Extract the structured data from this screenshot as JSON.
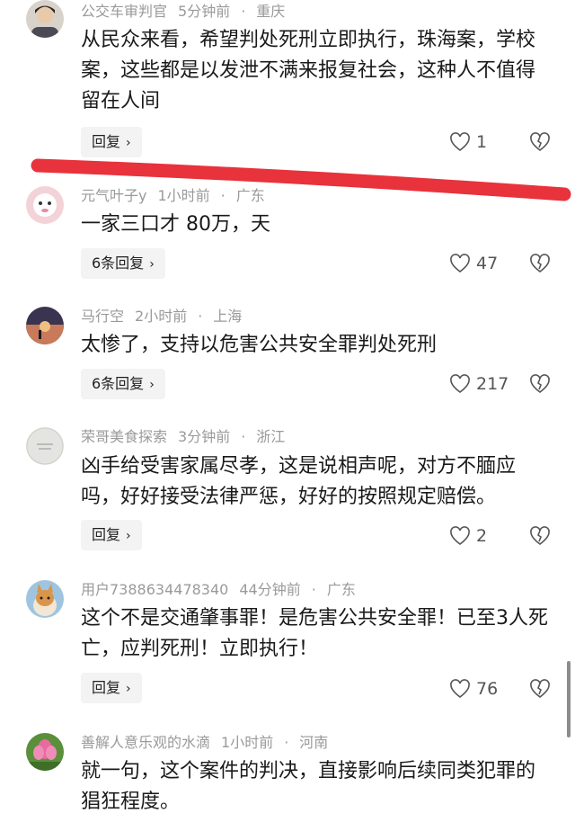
{
  "comments": [
    {
      "user": "公交车审判官",
      "time": "5分钟前",
      "location": "重庆",
      "text": "从民众来看，希望判处死刑立即执行，珠海案，学校案，这些都是以发泄不满来报复社会，这种人不值得留在人间",
      "reply_label": "回复",
      "likes": "1"
    },
    {
      "user": "元气叶子y",
      "time": "1小时前",
      "location": "广东",
      "text": "一家三口才 80万，天",
      "reply_label": "6条回复",
      "likes": "47"
    },
    {
      "user": "马行空",
      "time": "2小时前",
      "location": "上海",
      "text": "太惨了，支持以危害公共安全罪判处死刑",
      "reply_label": "6条回复",
      "likes": "217"
    },
    {
      "user": "荣哥美食探索",
      "time": "3分钟前",
      "location": "浙江",
      "text": "凶手给受害家属尽孝，这是说相声呢，对方不腼应吗，好好接受法律严惩，好好的按照规定赔偿。",
      "reply_label": "回复",
      "likes": "2"
    },
    {
      "user": "用户7388634478340",
      "time": "44分钟前",
      "location": "广东",
      "text": "这个不是交通肇事罪！是危害公共安全罪！已至3人死亡，应判死刑！立即执行！",
      "reply_label": "回复",
      "likes": "76"
    },
    {
      "user": "善解人意乐观的水滴",
      "time": "1小时前",
      "location": "河南",
      "text": "就一句，这个案件的判决，直接影响后续同类犯罪的猖狂程度。",
      "reply_label": "",
      "likes": ""
    }
  ],
  "colors": {
    "annotation_line": "#e8323c",
    "meta_text": "#9a9a9a",
    "body_text": "#1a1a1a",
    "reply_bg": "#f3f3f3"
  },
  "icons": {
    "like": "heart-outline-icon",
    "dislike": "broken-heart-icon",
    "reply_chevron": "chevron-right-icon"
  }
}
